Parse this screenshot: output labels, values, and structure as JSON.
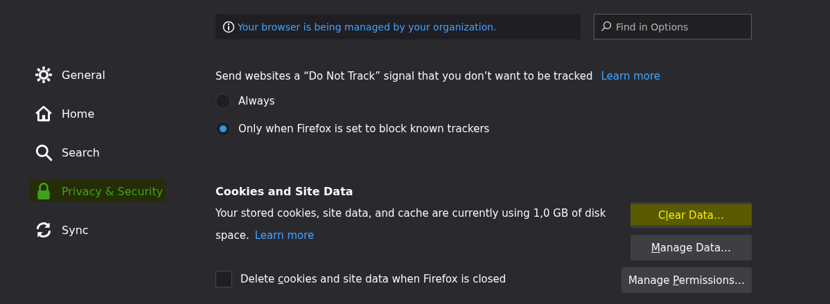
{
  "banner": {
    "text": "Your browser is being managed by your organization."
  },
  "search": {
    "placeholder": "Find in Options"
  },
  "sidebar": {
    "items": [
      {
        "kind": "gear",
        "label": "General",
        "selected": false,
        "highlighted": false
      },
      {
        "kind": "home",
        "label": "Home",
        "selected": false,
        "highlighted": false
      },
      {
        "kind": "search",
        "label": "Search",
        "selected": false,
        "highlighted": false
      },
      {
        "kind": "lock",
        "label": "Privacy & Security",
        "selected": true,
        "highlighted": true
      },
      {
        "kind": "sync",
        "label": "Sync",
        "selected": false,
        "highlighted": false
      }
    ]
  },
  "do_not_track": {
    "text": "Send websites a “Do Not Track” signal that you don’t want to be tracked",
    "link": "Learn more",
    "options": [
      {
        "label": "Always",
        "selected": false
      },
      {
        "label": "Only when Firefox is set to block known trackers",
        "selected": true
      }
    ]
  },
  "cookies": {
    "title": "Cookies and Site Data",
    "text": "Your stored cookies, site data, and cache are currently using 1,0 GB of disk space.",
    "link": "Learn more",
    "buttons": [
      {
        "before": "C",
        "key": "l",
        "after": "ear Data…",
        "highlighted": true
      },
      {
        "key": "M",
        "after": "anage Data…",
        "highlighted": false
      },
      {
        "before": "Manage ",
        "key": "P",
        "after": "ermissions…",
        "highlighted": false
      }
    ],
    "delete_on_close": {
      "before": "Delete ",
      "key": "c",
      "after": "ookies and site data when Firefox is closed",
      "checked": false
    }
  }
}
